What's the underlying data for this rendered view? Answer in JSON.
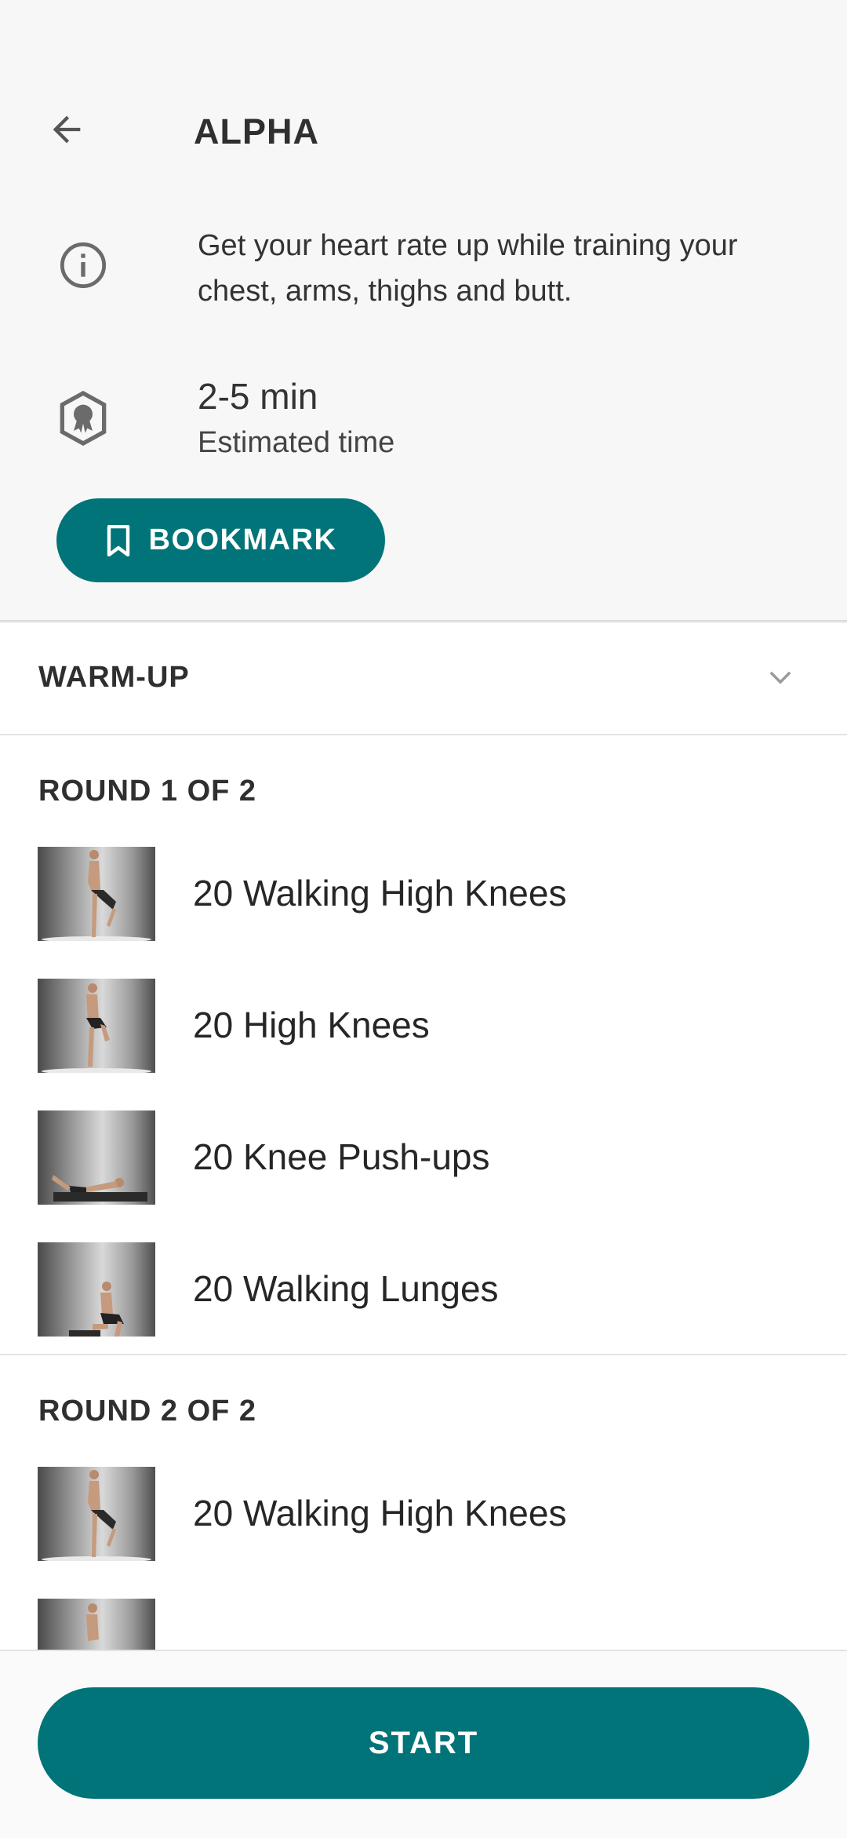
{
  "header": {
    "title": "ALPHA",
    "description": "Get your heart rate up while training your chest, arms, thighs and butt.",
    "duration": "2-5 min",
    "duration_label": "Estimated time",
    "bookmark_label": "BOOKMARK"
  },
  "warmup": {
    "label": "WARM-UP"
  },
  "rounds": [
    {
      "title": "ROUND 1 OF 2",
      "exercises": [
        {
          "name": "20 Walking High Knees"
        },
        {
          "name": "20 High Knees"
        },
        {
          "name": "20 Knee Push-ups"
        },
        {
          "name": "20 Walking Lunges"
        }
      ]
    },
    {
      "title": "ROUND 2 OF 2",
      "exercises": [
        {
          "name": "20 Walking High Knees"
        }
      ]
    }
  ],
  "footer": {
    "start_label": "START"
  },
  "colors": {
    "accent": "#007479",
    "background": "#f7f7f7"
  }
}
